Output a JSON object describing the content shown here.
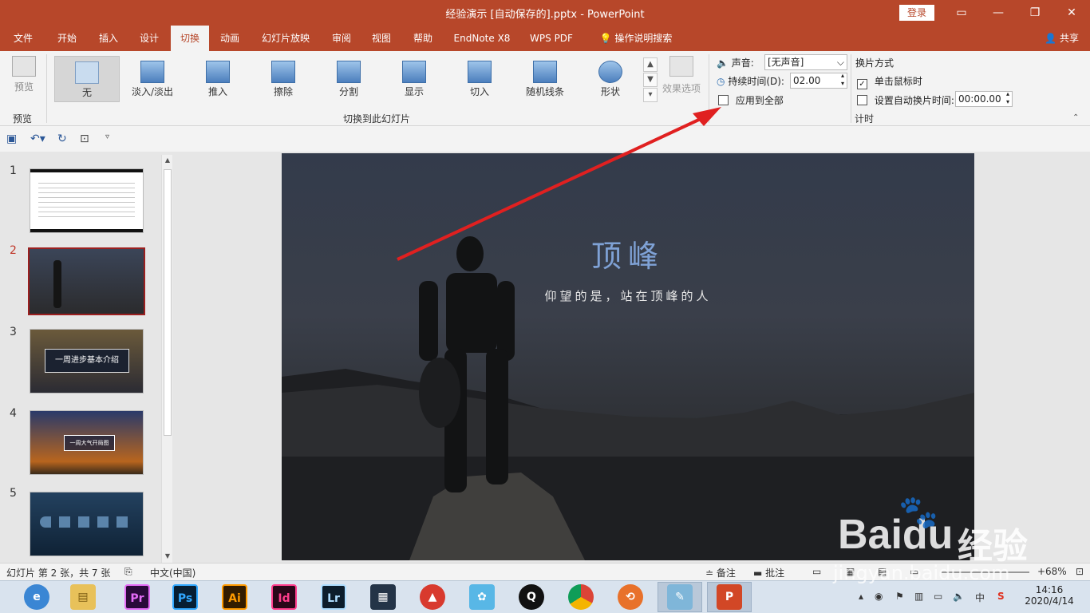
{
  "app": {
    "title": "经验演示 [自动保存的].pptx  -  PowerPoint",
    "login_label": "登录",
    "share_label": "共享"
  },
  "tabs": [
    {
      "label": "文件"
    },
    {
      "label": "开始"
    },
    {
      "label": "插入"
    },
    {
      "label": "设计"
    },
    {
      "label": "切换"
    },
    {
      "label": "动画"
    },
    {
      "label": "幻灯片放映"
    },
    {
      "label": "审阅"
    },
    {
      "label": "视图"
    },
    {
      "label": "帮助"
    },
    {
      "label": "EndNote X8"
    },
    {
      "label": "WPS PDF"
    },
    {
      "label": "操作说明搜索"
    }
  ],
  "ribbon": {
    "preview_label": "预览",
    "preview_group": "预览",
    "transitions": [
      {
        "label": "无"
      },
      {
        "label": "淡入/淡出"
      },
      {
        "label": "推入"
      },
      {
        "label": "擦除"
      },
      {
        "label": "分割"
      },
      {
        "label": "显示"
      },
      {
        "label": "切入"
      },
      {
        "label": "随机线条"
      },
      {
        "label": "形状"
      }
    ],
    "effect_options_label": "效果选项",
    "transition_group": "切换到此幻灯片",
    "sound_label": "声音:",
    "sound_value": "[无声音]",
    "duration_label": "持续时间(D):",
    "duration_value": "02.00",
    "apply_all_label": "应用到全部",
    "advance_heading": "换片方式",
    "on_click_label": "单击鼠标时",
    "auto_after_label": "设置自动换片时间:",
    "auto_after_value": "00:00.00",
    "timing_group": "计时"
  },
  "thumbnails": [
    {
      "num": "1"
    },
    {
      "num": "2"
    },
    {
      "num": "3",
      "text": "一周进步基本介绍"
    },
    {
      "num": "4",
      "text": "一周大气开局图"
    },
    {
      "num": "5"
    }
  ],
  "slide": {
    "title": "顶峰",
    "subtitle": "仰望的是，站在顶峰的人"
  },
  "status": {
    "slide_info": "幻灯片 第 2 张，共 7 张",
    "language": "中文(中国)",
    "notes_label": "备注",
    "comments_label": "批注",
    "zoom": "68%"
  },
  "taskbar": {
    "time": "14:16",
    "date": "2020/4/14",
    "ime": "中"
  },
  "watermark": {
    "brand_a": "Bai",
    "brand_b": "du",
    "brand_c": "经验",
    "url": "jingyan.baidu.com"
  }
}
